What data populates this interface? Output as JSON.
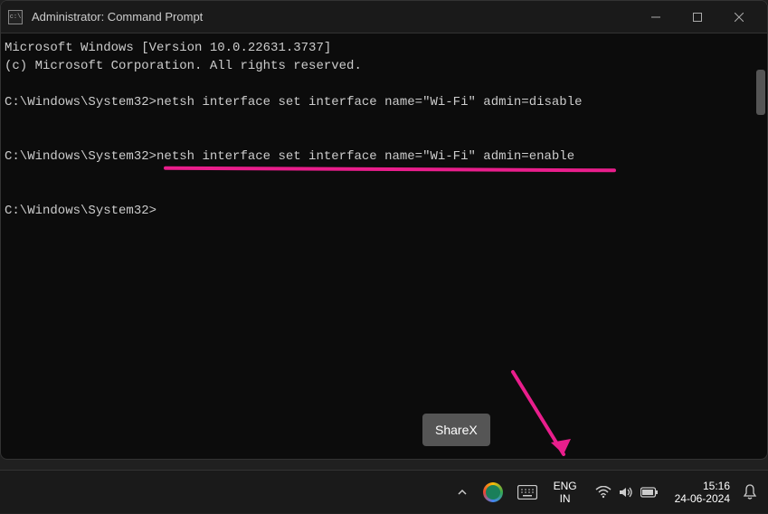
{
  "window": {
    "title": "Administrator: Command Prompt"
  },
  "terminal": {
    "header1": "Microsoft Windows [Version 10.0.22631.3737]",
    "header2": "(c) Microsoft Corporation. All rights reserved.",
    "prompt": "C:\\Windows\\System32>",
    "cmd1": "netsh interface set interface name=\"Wi-Fi\" admin=disable",
    "cmd2": "netsh interface set interface name=\"Wi-Fi\" admin=enable"
  },
  "annotation": {
    "underline_color": "#e91e8c",
    "arrow_color": "#e91e8c"
  },
  "sharex": {
    "label": "ShareX"
  },
  "taskbar": {
    "lang_top": "ENG",
    "lang_bottom": "IN",
    "time": "15:16",
    "date": "24-06-2024"
  }
}
